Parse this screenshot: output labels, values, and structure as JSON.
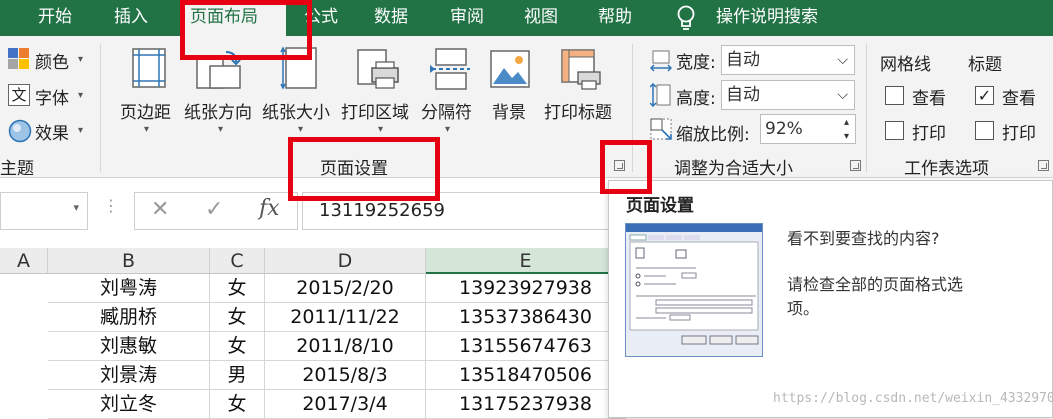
{
  "tabs": [
    {
      "label": "开始"
    },
    {
      "label": "插入"
    },
    {
      "label": "页面布局"
    },
    {
      "label": "公式"
    },
    {
      "label": "数据"
    },
    {
      "label": "审阅"
    },
    {
      "label": "视图"
    },
    {
      "label": "帮助"
    },
    {
      "label": "操作说明搜索"
    }
  ],
  "ribbon": {
    "theme": {
      "colors": "颜色",
      "fonts": "字体",
      "effects": "效果",
      "group": "主题"
    },
    "page_setup": {
      "margins": "页边距",
      "orientation": "纸张方向",
      "size": "纸张大小",
      "print_area": "打印区域",
      "breaks": "分隔符",
      "background": "背景",
      "print_titles": "打印标题",
      "group": "页面设置"
    },
    "scale_to_fit": {
      "width_label": "宽度:",
      "width_value": "自动",
      "height_label": "高度:",
      "height_value": "自动",
      "scale_label": "缩放比例:",
      "scale_value": "92%",
      "group": "调整为合适大小"
    },
    "sheet_options": {
      "gridlines": "网格线",
      "headings": "标题",
      "view": "查看",
      "print": "打印",
      "group": "工作表选项"
    }
  },
  "formula_bar": {
    "fx": "fx",
    "value": "13119252659"
  },
  "columns": [
    "A",
    "B",
    "C",
    "D",
    "E"
  ],
  "rows": [
    {
      "name": "刘粤涛",
      "gender": "女",
      "date": "2015/2/20",
      "phone": "13923927938"
    },
    {
      "name": "臧朋桥",
      "gender": "女",
      "date": "2011/11/22",
      "phone": "13537386430"
    },
    {
      "name": "刘惠敏",
      "gender": "女",
      "date": "2011/8/10",
      "phone": "13155674763"
    },
    {
      "name": "刘景涛",
      "gender": "男",
      "date": "2015/8/3",
      "phone": "13518470506"
    },
    {
      "name": "刘立冬",
      "gender": "女",
      "date": "2017/3/4",
      "phone": "13175237938"
    }
  ],
  "right_edge": {
    "col": "C",
    "cell": "2"
  },
  "tooltip": {
    "title": "页面设置",
    "line1": "看不到要查找的内容?",
    "line2": "请检查全部的页面格式选项。"
  },
  "watermark": "https://blog.csdn.net/weixin_43329700",
  "colors": {
    "excel_green": "#217346",
    "highlight_red": "#e60012"
  }
}
